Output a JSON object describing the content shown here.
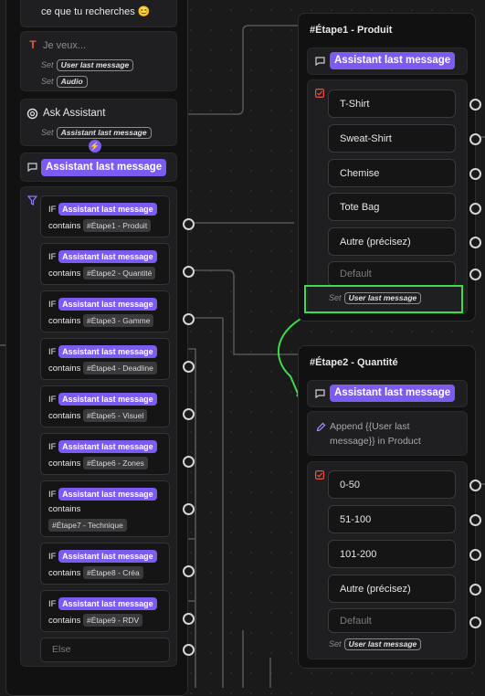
{
  "colors": {
    "accent": "#7c5cf0",
    "highlight": "#3ddc4a",
    "canvas": "#1a1a1b"
  },
  "left": {
    "top_text": "ce que tu recherches 😊",
    "text_input": {
      "label": "Je veux...",
      "set_label": "Set",
      "var1": "User last message",
      "var2": "Audio"
    },
    "ask_assistant": {
      "title": "Ask Assistant",
      "set_label": "Set",
      "var": "Assistant last message"
    },
    "bubble": {
      "variable": "Assistant last message"
    },
    "conditions": [
      {
        "if": "IF",
        "var": "Assistant last message",
        "op": "contains",
        "value": "#Étape1 - Produit"
      },
      {
        "if": "IF",
        "var": "Assistant last message",
        "op": "contains",
        "value": "#Étape2 - Quantité"
      },
      {
        "if": "IF",
        "var": "Assistant last message",
        "op": "contains",
        "value": "#Étape3 - Gamme"
      },
      {
        "if": "IF",
        "var": "Assistant last message",
        "op": "contains",
        "value": "#Étape4 - Deadline"
      },
      {
        "if": "IF",
        "var": "Assistant last message",
        "op": "contains",
        "value": "#Étape5 - Visuel"
      },
      {
        "if": "IF",
        "var": "Assistant last message",
        "op": "contains",
        "value": "#Étape6 - Zones"
      },
      {
        "if": "IF",
        "var": "Assistant last message",
        "op": "contains",
        "value": "#Étape7 - Technique"
      },
      {
        "if": "IF",
        "var": "Assistant last message",
        "op": "contains",
        "value": "#Étape8 - Créa"
      },
      {
        "if": "IF",
        "var": "Assistant last message",
        "op": "contains",
        "value": "#Étape9 - RDV"
      }
    ],
    "else_label": "Else"
  },
  "etape1": {
    "title": "#Étape1 - Produit",
    "bubble_var": "Assistant last message",
    "choices": [
      "T-Shirt",
      "Sweat-Shirt",
      "Chemise",
      "Tote Bag",
      "Autre (précisez)"
    ],
    "default_label": "Default",
    "set_label": "Set",
    "set_var": "User last message"
  },
  "etape2": {
    "title": "#Étape2 - Quantité",
    "bubble_var": "Assistant last message",
    "append_text_1": "Append {{User last",
    "append_text_2": "message}} in Product",
    "choices": [
      "0-50",
      "51-100",
      "101-200",
      "Autre (précisez)"
    ],
    "default_label": "Default",
    "set_label": "Set",
    "set_var": "User last message"
  }
}
